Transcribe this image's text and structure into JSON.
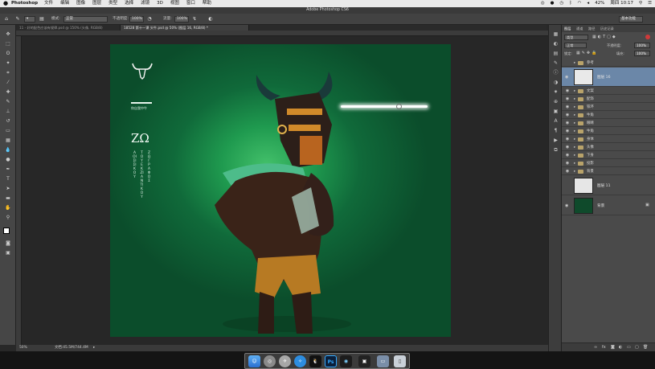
{
  "menubar": {
    "app": "Photoshop",
    "items": [
      "文件",
      "编辑",
      "图像",
      "图层",
      "类型",
      "选择",
      "滤镜",
      "3D",
      "视图",
      "窗口",
      "帮助"
    ],
    "battery": "42%",
    "clock": "周四 10:17"
  },
  "titlebar": {
    "title": "Adobe Photoshop CS6"
  },
  "options": {
    "mode_label": "模式:",
    "mode_value": "正常",
    "opacity_label": "不透明度:",
    "opacity_value": "100%",
    "flow_label": "流量:",
    "flow_value": "100%",
    "workspace": "基本功能"
  },
  "tabs": [
    {
      "label": "11 - 好的配色应该有规律.psd @ 150% (头像, RGB/8)",
      "active": false
    },
    {
      "label": "18528 第十一课 头牛.psd @ 50% (图层 16, RGB/8) *",
      "active": true
    }
  ],
  "status": {
    "zoom": "50%",
    "doc": "文档:45.5M/744.4M"
  },
  "artboard": {
    "headline": "ΖΩ",
    "small_caption": "你自我中牛",
    "vertical_columns": [
      "ΑΟΙΣΙΣΙΚΟΥ",
      "ΤΟΥΕΚΖΙΑΝΤΙΚΟΥ",
      "ΖΩΓΡΑΦΟΣ"
    ],
    "background_color": "#0e5a32",
    "glow_color": "#3fd472"
  },
  "panels": {
    "tabs": [
      "图层",
      "通道",
      "路径",
      "历史记录"
    ],
    "kind_label": "类型",
    "blend_value": "正常",
    "opacity_label": "不透明度:",
    "opacity_value": "100%",
    "lock_label": "锁定:",
    "fill_label": "填充:",
    "fill_value": "100%",
    "layers": [
      {
        "type": "group",
        "name": "参考",
        "visible": false
      },
      {
        "type": "big",
        "name": "图层 16",
        "visible": true,
        "selected": true,
        "thumb": "#e9e9e9"
      },
      {
        "type": "group",
        "name": "文案",
        "visible": true
      },
      {
        "type": "group",
        "name": "配饰",
        "visible": true
      },
      {
        "type": "group",
        "name": "铁环",
        "visible": true
      },
      {
        "type": "group",
        "name": "牛角",
        "visible": true
      },
      {
        "type": "group",
        "name": "眼睛",
        "visible": true
      },
      {
        "type": "group",
        "name": "牛角",
        "visible": true
      },
      {
        "type": "group",
        "name": "身体",
        "visible": true
      },
      {
        "type": "group",
        "name": "头像",
        "visible": true
      },
      {
        "type": "group",
        "name": "下身",
        "visible": true
      },
      {
        "type": "group",
        "name": "投影",
        "visible": true
      },
      {
        "type": "group",
        "name": "背景",
        "visible": true
      },
      {
        "type": "big",
        "name": "图层 11",
        "visible": false,
        "selected": false,
        "thumb": "#e6e6e6"
      },
      {
        "type": "big",
        "name": "背景",
        "visible": true,
        "selected": false,
        "thumb": "#0f4a2b",
        "locked": true
      }
    ],
    "footer_icons": [
      "link-icon",
      "fx-icon",
      "mask-icon",
      "adjustment-icon",
      "folder-icon",
      "new-layer-icon",
      "trash-icon"
    ]
  },
  "dock": {
    "apps": [
      "finder",
      "launchpad",
      "safari",
      "compass",
      "qq",
      "photoshop",
      "illustrator",
      "edge",
      "terminal",
      "preview",
      "trash"
    ]
  }
}
